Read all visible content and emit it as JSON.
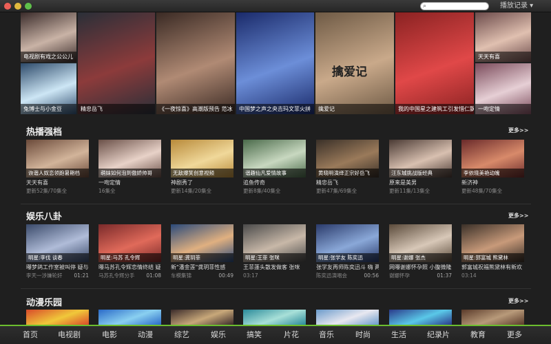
{
  "titlebar": {
    "history_label": "播放记录 ▾",
    "search_placeholder": ""
  },
  "hero": [
    {
      "caption": "电视剧有戏之公公儿",
      "c1": "#3a2b2a",
      "c2": "#c9b3a6"
    },
    {
      "caption": "兔博士与小金豆",
      "c1": "#2d4a6a",
      "c2": "#cde6f5"
    },
    {
      "caption": "精忠岳飞",
      "c1": "#2a2f38",
      "c2": "#8c3b3b"
    },
    {
      "caption": "《一夜惊喜》高潮版预告 范冰",
      "c1": "#3a2a24",
      "c2": "#b08a74"
    },
    {
      "caption": "中国梦之声之央吉玛文菲火拼",
      "c1": "#1a2a6a",
      "c2": "#6c8ed8"
    },
    {
      "caption": "擒爱记",
      "c1": "#6e5a45",
      "c2": "#c9a98a"
    },
    {
      "caption": "我的中国星之建筑工引发惜仁飘",
      "c1": "#8a2222",
      "c2": "#e04848"
    },
    {
      "caption": "天天有喜",
      "c1": "#6b4a4a",
      "c2": "#e0c0b0"
    },
    {
      "caption": "一吻定情",
      "c1": "#7a4a5a",
      "c2": "#e6cfd5"
    }
  ],
  "hero_title_text": "擒爱记",
  "sections": {
    "hot": {
      "title": "热播强档",
      "more": "更多>>"
    },
    "ent": {
      "title": "娱乐八卦",
      "more": "更多>>"
    },
    "anime": {
      "title": "动漫乐园",
      "more": "更多>>"
    }
  },
  "hot_cards": [
    {
      "cap": "诙谐人奴恋领跑暑期档",
      "t1": "天天有喜",
      "t2": "更新52集/70集全",
      "c1": "#6b4a3a",
      "c2": "#d2b49a"
    },
    {
      "cap": "萌妹如何泡到傲娇帅哥",
      "t1": "一吻定情",
      "t2": "16集全",
      "c1": "#6a5048",
      "c2": "#e8d2c8"
    },
    {
      "cap": "无敌爆笑创意视频",
      "t1": "神剧秀了",
      "t2": "更新14集/20集全",
      "c1": "#b88a3a",
      "c2": "#f0d89a"
    },
    {
      "cap": "谐趣仙凡爱情故事",
      "t1": "追鱼传奇",
      "t2": "更新8集/40集全",
      "c1": "#4a6a4a",
      "c2": "#c8d8c0"
    },
    {
      "cap": "黄晓明演绎正宗好岳飞",
      "t1": "精忠岳飞",
      "t2": "更新47集/69集全",
      "c1": "#3a3028",
      "c2": "#9a7a5a"
    },
    {
      "cap": "汪东城挑战版经典",
      "t1": "原来是美男",
      "t2": "更新11集/13集全",
      "c1": "#4a3a34",
      "c2": "#d8c0b0"
    },
    {
      "cap": "李依晓美艳动魄",
      "t1": "新济神",
      "t2": "更新48集/70集全",
      "c1": "#6a2a2a",
      "c2": "#d88a6a"
    }
  ],
  "ent_cards": [
    {
      "cap": "明星:李伐 谈春",
      "t1": "曝梦鸽工作室被叫停 疑与",
      "t2": "李天一涉嫌轮奸",
      "dur": "01:21",
      "c1": "#3a4a6a",
      "c2": "#b0bcd8"
    },
    {
      "cap": "明星:马苏 孔令辉",
      "t1": "曝马苏孔令辉恋情终结 疑",
      "t2": "马苏孔令辉分手",
      "dur": "01:08",
      "c1": "#7a2a2a",
      "c2": "#e06a5a"
    },
    {
      "cap": "明星:龚玥菲",
      "t1": "新\"潘金莲\"龚玥菲性感",
      "t2": "车模集锦",
      "dur": "00:49",
      "c1": "#2a4a7a",
      "c2": "#e0b080"
    },
    {
      "cap": "明星:王菲 张咪",
      "t1": "王菲蓬头散发做客 张咪",
      "t2": "03:17",
      "dur": "",
      "c1": "#4a4a4a",
      "c2": "#c8b8a8"
    },
    {
      "cap": "明星:张学友 陈奕迅",
      "t1": "张学友再师陈奕迅斗 嗨 两",
      "t2": "陈奕迅演唱会",
      "dur": "00:56",
      "c1": "#2a3a6a",
      "c2": "#8aa8d8"
    },
    {
      "cap": "明星:谢娜 张杰",
      "t1": "网曝谢娜怀孕照 小腹微隆",
      "t2": "谢娜怀孕",
      "dur": "01:37",
      "c1": "#5a4a3a",
      "c2": "#d8c8b8"
    },
    {
      "cap": "明星:郭富城 熊黛林",
      "t1": "郭富城祝福熊黛林有新欢",
      "t2": "03:14",
      "dur": "",
      "c1": "#3a3028",
      "c2": "#c89a7a"
    }
  ],
  "anime_cards": [
    {
      "c1": "#d84a2a",
      "c2": "#f0c83a"
    },
    {
      "c1": "#2a6ac8",
      "c2": "#8ad0f0"
    },
    {
      "c1": "#3a2a2a",
      "c2": "#c8a87a"
    },
    {
      "c1": "#2a8a9a",
      "c2": "#a8e0d8"
    },
    {
      "c1": "#6a9aca",
      "c2": "#e8e8f0"
    },
    {
      "c1": "#2a3a8a",
      "c2": "#5ac8e8"
    },
    {
      "c1": "#5a3a2a",
      "c2": "#b89a7a"
    }
  ],
  "nav": [
    "首页",
    "电视剧",
    "电影",
    "动漫",
    "综艺",
    "娱乐",
    "搞笑",
    "片花",
    "音乐",
    "时尚",
    "生活",
    "纪录片",
    "教育",
    "更多"
  ],
  "colors": {
    "accent": "#6cbf2e",
    "background": "#1f1f1f"
  }
}
